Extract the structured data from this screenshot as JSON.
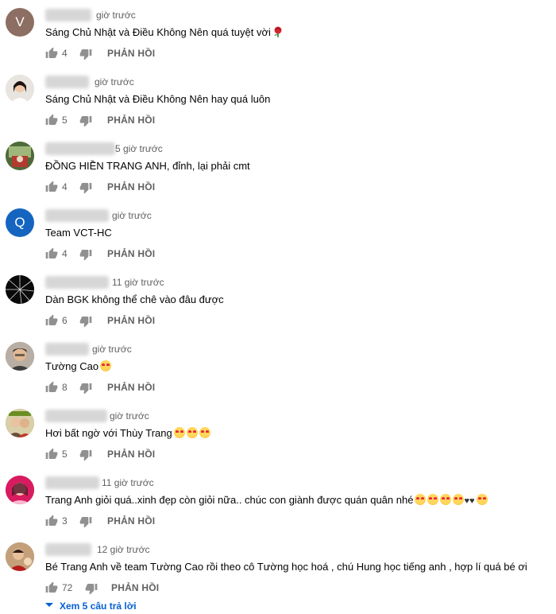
{
  "icons": {
    "like": "thumb-up-icon",
    "dislike": "thumb-down-icon"
  },
  "colors": {
    "link": "#065fd4",
    "meta": "#606060",
    "text": "#030303"
  },
  "reply_label": "PHẢN HỒI",
  "comments": [
    {
      "avatar_letter": "V",
      "avatar_color": "#8d6e63",
      "time": "giờ trước",
      "text": "Sáng Chủ Nhật và Điều Không Nên quá tuyệt vời",
      "emoji": [
        "rose"
      ],
      "likes": "4"
    },
    {
      "avatar_letter": "",
      "avatar_color": "#e8e4df",
      "time": "giờ trước",
      "text": "Sáng Chủ Nhật và Điều Không Nên hay quá luôn",
      "emoji": [],
      "likes": "5"
    },
    {
      "avatar_letter": "",
      "avatar_color": "#7b8a5a",
      "time": "5 giờ trước",
      "text": "ĐỒNG HIỀN TRANG ANH, đỉnh, lại phải cmt",
      "emoji": [],
      "likes": "4"
    },
    {
      "avatar_letter": "Q",
      "avatar_color": "#1565c0",
      "time": "giờ trước",
      "text": "Team VCT-HC",
      "emoji": [],
      "likes": "4"
    },
    {
      "avatar_letter": "",
      "avatar_color": "#111111",
      "time": "11 giờ trước",
      "text": "Dàn BGK không thể chê vào đâu được",
      "emoji": [],
      "likes": "6"
    },
    {
      "avatar_letter": "",
      "avatar_color": "#6d5a4c",
      "time": "giờ trước",
      "text": "Tường Cao",
      "emoji": [
        "heart-eyes"
      ],
      "likes": "8"
    },
    {
      "avatar_letter": "",
      "avatar_color": "#a08a60",
      "time": "giờ trước",
      "text": "Hơi bất ngờ với Thùy Trang",
      "emoji": [
        "heart-eyes",
        "heart-eyes",
        "heart-eyes"
      ],
      "likes": "5"
    },
    {
      "avatar_letter": "",
      "avatar_color": "#c2185b",
      "time": "11 giờ trước",
      "text": "Trang Anh giỏi quá..xinh đẹp còn giỏi nữa.. chúc con giành được quán quân nhé",
      "emoji": [
        "heart-eyes",
        "heart-eyes",
        "heart-eyes",
        "heart-eyes",
        "hearts",
        "heart-eyes"
      ],
      "likes": "3"
    },
    {
      "avatar_letter": "",
      "avatar_color": "#8a6a4a",
      "time": "12 giờ trước",
      "text": "Bé Trang Anh về team Tường Cao rồi theo cô Tường học hoá , chú Hung học tiếng anh , hợp lí quá bé ơi",
      "emoji": [],
      "likes": "72"
    }
  ],
  "view_replies": "Xem 5 câu trả lời"
}
